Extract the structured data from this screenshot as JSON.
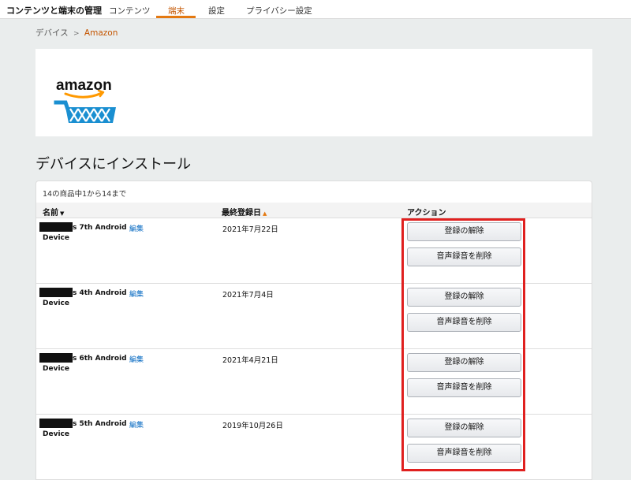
{
  "nav": {
    "title": "コンテンツと端末の管理",
    "tabs": [
      {
        "label": "コンテンツ"
      },
      {
        "label": "端末"
      },
      {
        "label": "設定"
      },
      {
        "label": "プライバシー設定"
      }
    ]
  },
  "breadcrumb": {
    "parent": "デバイス",
    "separator": ">",
    "current": "Amazon"
  },
  "logo": {
    "text": "amazon"
  },
  "section": {
    "heading": "デバイスにインストール"
  },
  "table": {
    "count_text": "14の商品中1から14まで",
    "headers": {
      "name": "名前",
      "date": "最終登録日",
      "action": "アクション"
    },
    "edit_label": "編集",
    "deregister_label": "登録の解除",
    "delete_voice_label": "音声録音を削除",
    "rows": [
      {
        "name_line1": "s 7th Android",
        "name_line2": "Device",
        "date": "2021年7月22日"
      },
      {
        "name_line1": "s 4th Android",
        "name_line2": "Device",
        "date": "2021年7月4日"
      },
      {
        "name_line1": "s 6th Android",
        "name_line2": "Device",
        "date": "2021年4月21日"
      },
      {
        "name_line1": "s 5th Android",
        "name_line2": "Device",
        "date": "2019年10月26日"
      }
    ]
  },
  "colors": {
    "accent": "#e47911",
    "link": "#0066c0",
    "highlight": "#e0201f",
    "background": "#eaeded"
  }
}
